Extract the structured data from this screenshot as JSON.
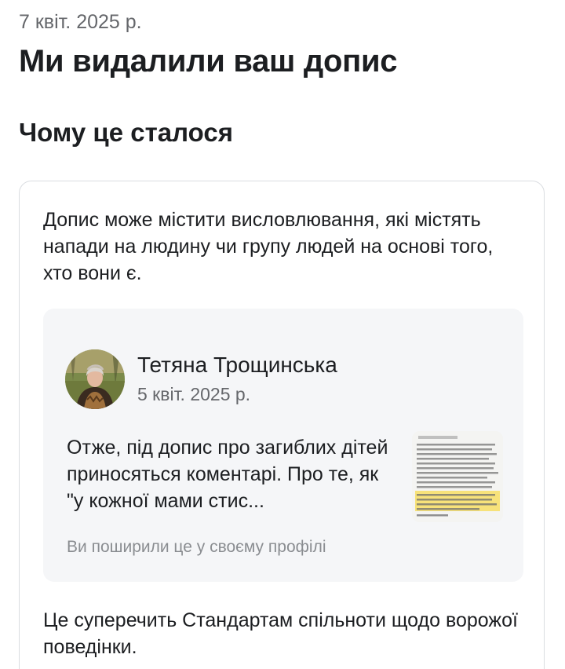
{
  "notice": {
    "date": "7 квіт. 2025 р.",
    "title": "Ми видалили ваш допис",
    "section_title": "Чому це сталося"
  },
  "card": {
    "reason_text": "Допис може містити висловлювання, які містять напади на людину чи групу людей на основі того, хто вони є.",
    "post": {
      "author": "Тетяна Трощинська",
      "date": "5 квіт. 2025 р.",
      "text": "Отже, під допис про загиблих дітей приносяться коментарі. Про те, як \"у кожної мами стис...",
      "shared_label": "Ви поширили це у своєму профілі",
      "avatar_icon": "profile-photo",
      "thumbnail_icon": "screenshot-thumbnail"
    },
    "violation_text": "Це суперечить Стандартам спільноти щодо ворожої поведінки."
  },
  "colors": {
    "primary_text": "#1c1e21",
    "secondary_text": "#65676b",
    "muted_text": "#8a8d91",
    "card_border": "#dadde1",
    "post_background": "#f5f6f8",
    "highlight": "#f7e27a"
  }
}
